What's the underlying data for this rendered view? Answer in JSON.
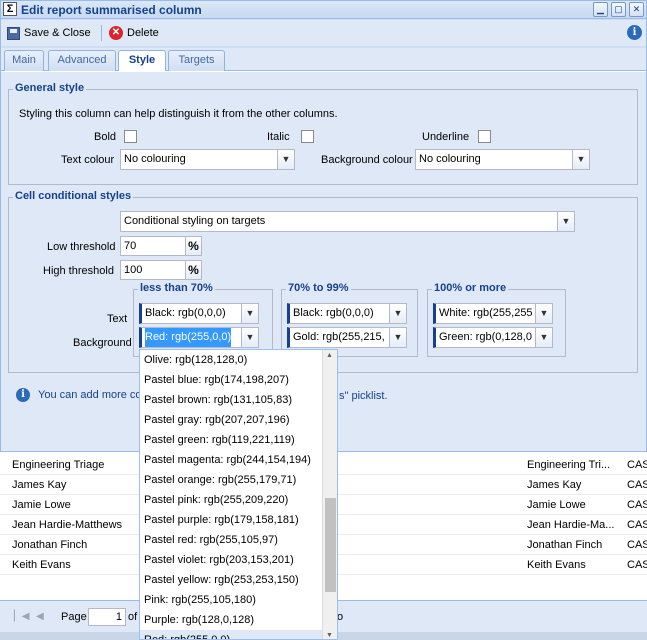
{
  "window": {
    "title": "Edit report summarised column"
  },
  "toolbar": {
    "save_label": "Save & Close",
    "delete_label": "Delete"
  },
  "tabs": [
    {
      "label": "Main"
    },
    {
      "label": "Advanced"
    },
    {
      "label": "Style"
    },
    {
      "label": "Targets"
    }
  ],
  "general": {
    "legend": "General style",
    "description": "Styling this column can help distinguish it from the other columns.",
    "bold_label": "Bold",
    "italic_label": "Italic",
    "underline_label": "Underline",
    "text_colour_label": "Text colour",
    "text_colour_value": "No colouring",
    "bg_colour_label": "Background colour",
    "bg_colour_value": "No colouring"
  },
  "conditional": {
    "legend": "Cell conditional styles",
    "mode_value": "Conditional styling on targets",
    "low_label": "Low threshold",
    "low_value": "70",
    "high_label": "High threshold",
    "high_value": "100",
    "pct_symbol": "%",
    "text_row_label": "Text",
    "bg_row_label": "Background",
    "groups": [
      {
        "legend": "less than 70%",
        "text_value": "Black: rgb(0,0,0)",
        "bg_value": "Red: rgb(255,0,0)"
      },
      {
        "legend": "70% to 99%",
        "text_value": "Black: rgb(0,0,0)",
        "bg_value": "Gold: rgb(255,215,"
      },
      {
        "legend": "100% or more",
        "text_value": "White: rgb(255,255",
        "bg_value": "Green: rgb(0,128,0"
      }
    ]
  },
  "info": {
    "prefix": "You can add more co",
    "suffix": "s\" picklist."
  },
  "dropdown_items": [
    "Olive: rgb(128,128,0)",
    "Pastel blue: rgb(174,198,207)",
    "Pastel brown: rgb(131,105,83)",
    "Pastel gray: rgb(207,207,196)",
    "Pastel green: rgb(119,221,119)",
    "Pastel magenta: rgb(244,154,194)",
    "Pastel orange: rgb(255,179,71)",
    "Pastel pink: rgb(255,209,220)",
    "Pastel purple: rgb(179,158,181)",
    "Pastel red: rgb(255,105,97)",
    "Pastel violet: rgb(203,153,201)",
    "Pastel yellow: rgb(253,253,150)",
    "Pink: rgb(255,105,180)",
    "Purple: rgb(128,0,128)",
    "Red: rgb(255,0,0)"
  ],
  "grid_rows": [
    {
      "name": "Engineering Triage",
      "col2": "Engineering Tri...",
      "col3": "CAS"
    },
    {
      "name": "James Kay",
      "col2": "James Kay",
      "col3": "CAS"
    },
    {
      "name": "Jamie Lowe",
      "col2": "Jamie Lowe",
      "col3": "CAS"
    },
    {
      "name": "Jean Hardie-Matthews",
      "col2": "Jean Hardie-Ma...",
      "col3": "CAS"
    },
    {
      "name": "Jonathan Finch",
      "col2": "Jonathan Finch",
      "col3": "CAS"
    },
    {
      "name": "Keith Evans",
      "col2": "Keith Evans",
      "col3": "CAS"
    }
  ],
  "pager": {
    "page_label": "Page",
    "page_value": "1",
    "of_label": "of",
    "tail": "o"
  }
}
